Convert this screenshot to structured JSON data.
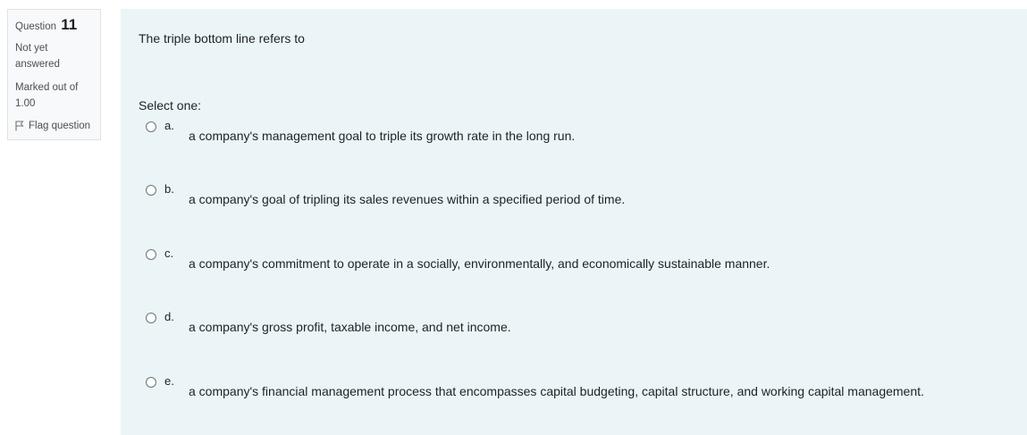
{
  "question_info": {
    "question_label": "Question",
    "question_number": "11",
    "state": "Not yet answered",
    "grade": "Marked out of 1.00",
    "flag_label": "Flag question"
  },
  "question": {
    "text": "The triple bottom line refers to",
    "prompt": "Select one:",
    "options": [
      {
        "letter": "a.",
        "text": "a company's management goal to triple its growth rate in the long run."
      },
      {
        "letter": "b.",
        "text": "a company's goal of tripling its sales revenues within a specified period of time."
      },
      {
        "letter": "c.",
        "text": "a company's commitment to operate in a socially, environmentally, and economically sustainable manner."
      },
      {
        "letter": "d.",
        "text": "a company's gross profit, taxable income, and net income."
      },
      {
        "letter": "e.",
        "text": "a company's financial management process that encompasses capital budgeting, capital structure, and working capital management."
      }
    ]
  },
  "colors": {
    "content_background": "#ebf5f8",
    "info_background": "#f8f9fa",
    "text": "#1d2125"
  }
}
